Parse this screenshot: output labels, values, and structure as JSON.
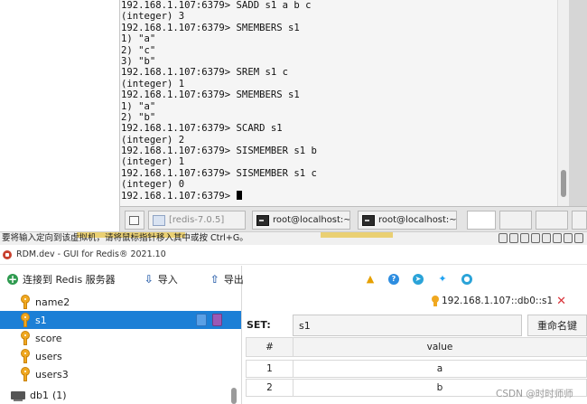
{
  "terminal": {
    "lines": [
      "192.168.1.107:6379> SADD s1 a b c",
      "(integer) 3",
      "192.168.1.107:6379> SMEMBERS s1",
      "1) \"a\"",
      "2) \"c\"",
      "3) \"b\"",
      "192.168.1.107:6379> SREM s1 c",
      "(integer) 1",
      "192.168.1.107:6379> SMEMBERS s1",
      "1) \"a\"",
      "2) \"b\"",
      "192.168.1.107:6379> SCARD s1",
      "(integer) 2",
      "192.168.1.107:6379> SISMEMBER s1 b",
      "(integer) 1",
      "192.168.1.107:6379> SISMEMBER s1 c",
      "(integer) 0"
    ],
    "prompt": "192.168.1.107:6379> "
  },
  "taskbar": {
    "item1": "[redis-7.0.5]",
    "item2": "root@localhost:~",
    "item3": "root@localhost:~"
  },
  "vm_status": {
    "text": "要将输入定向到该虚拟机，请将鼠标指针移入其中或按 Ctrl+G。"
  },
  "app": {
    "title": "RDM.dev - GUI for Redis® 2021.10"
  },
  "toolbar": {
    "connect": "连接到 Redis 服务器",
    "import": "导入",
    "export": "导出"
  },
  "tree": {
    "keys": [
      "name2",
      "s1",
      "score",
      "users",
      "users3"
    ],
    "selected_key": "s1",
    "db_label": "db1",
    "db_count": "(1)"
  },
  "key_view": {
    "connection_label": "192.168.1.107::db0::s1",
    "type_label": "SET:",
    "key_name": "s1",
    "rename_label": "重命名键",
    "col_index": "#",
    "col_value": "value",
    "rows": [
      {
        "index": "1",
        "value": "a"
      },
      {
        "index": "2",
        "value": "b"
      }
    ]
  },
  "watermark": "CSDN @时时师师",
  "colors": {
    "selection": "#1c7fd6",
    "key_icon": "#f0a820",
    "close": "#d9343a"
  }
}
